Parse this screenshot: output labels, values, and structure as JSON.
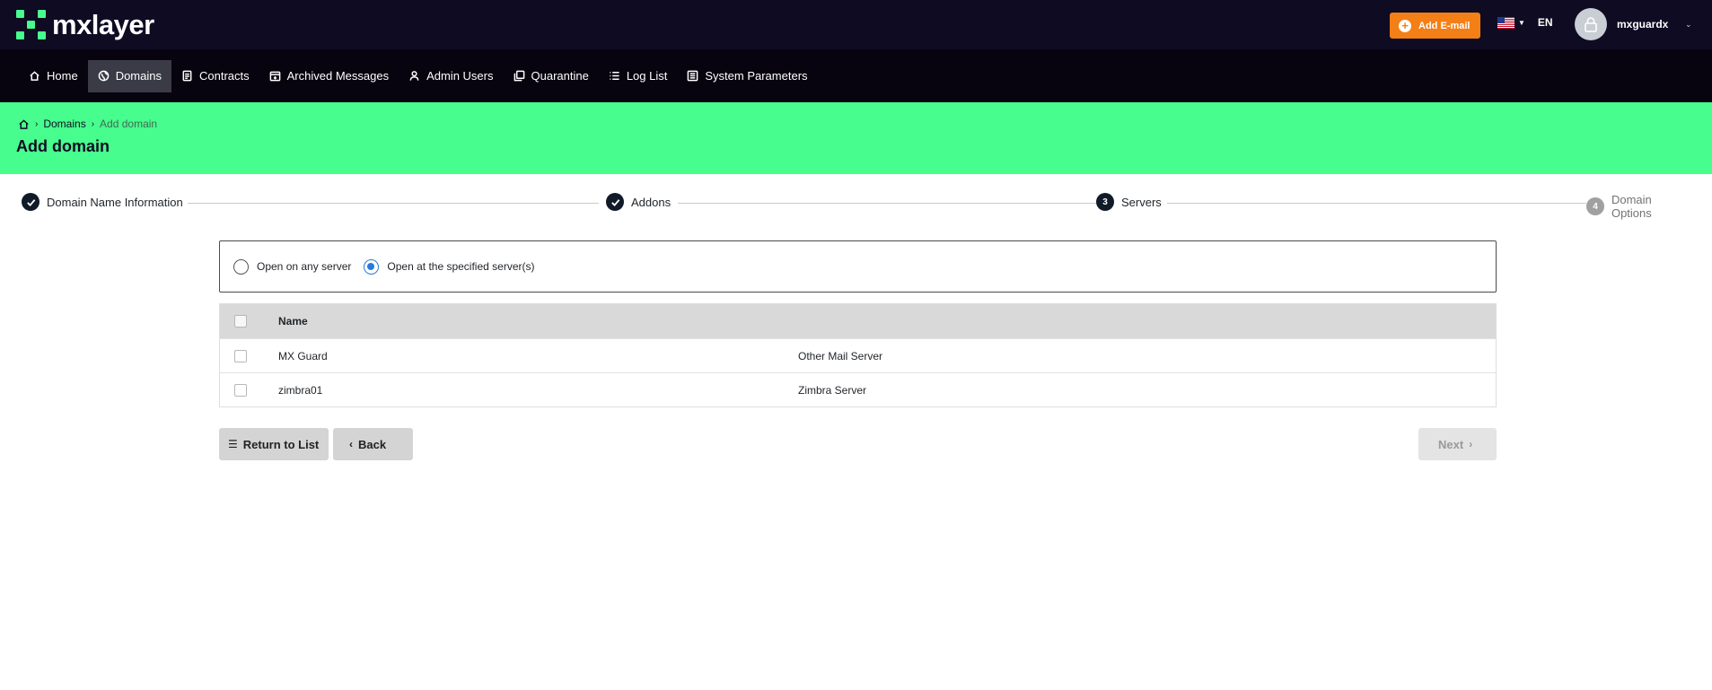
{
  "app": {
    "logo_text": "mxlayer",
    "brand_color": "#47fd8d",
    "accent_color": "#f47f16"
  },
  "header": {
    "add_email_label": "Add E-mail",
    "language": "EN",
    "user_name": "mxguardx"
  },
  "nav": {
    "items": [
      {
        "label": "Home",
        "icon": "home-icon",
        "active": false
      },
      {
        "label": "Domains",
        "icon": "globe-icon",
        "active": true
      },
      {
        "label": "Contracts",
        "icon": "contract-icon",
        "active": false
      },
      {
        "label": "Archived Messages",
        "icon": "archive-icon",
        "active": false
      },
      {
        "label": "Admin Users",
        "icon": "user-icon",
        "active": false
      },
      {
        "label": "Quarantine",
        "icon": "quarantine-icon",
        "active": false
      },
      {
        "label": "Log List",
        "icon": "list-icon",
        "active": false
      },
      {
        "label": "System Parameters",
        "icon": "settings-icon",
        "active": false
      }
    ]
  },
  "breadcrumb": {
    "home_icon": "home-icon",
    "domains": "Domains",
    "current": "Add domain"
  },
  "page_title": "Add domain",
  "steps": [
    {
      "label": "Domain Name Information",
      "state": "done",
      "number": ""
    },
    {
      "label": "Addons",
      "state": "done",
      "number": ""
    },
    {
      "label": "Servers",
      "state": "current",
      "number": "3"
    },
    {
      "label": "Domain Options",
      "state": "pending",
      "number": "4"
    }
  ],
  "server_mode": {
    "options": [
      {
        "label": "Open on any server",
        "checked": false
      },
      {
        "label": "Open at the specified server(s)",
        "checked": true
      }
    ]
  },
  "table": {
    "header_name": "Name",
    "rows": [
      {
        "name": "MX Guard",
        "type": "Other Mail Server"
      },
      {
        "name": "zimbra01",
        "type": "Zimbra Server"
      }
    ]
  },
  "buttons": {
    "return_label": "Return to List",
    "back_label": "Back",
    "next_label": "Next"
  }
}
